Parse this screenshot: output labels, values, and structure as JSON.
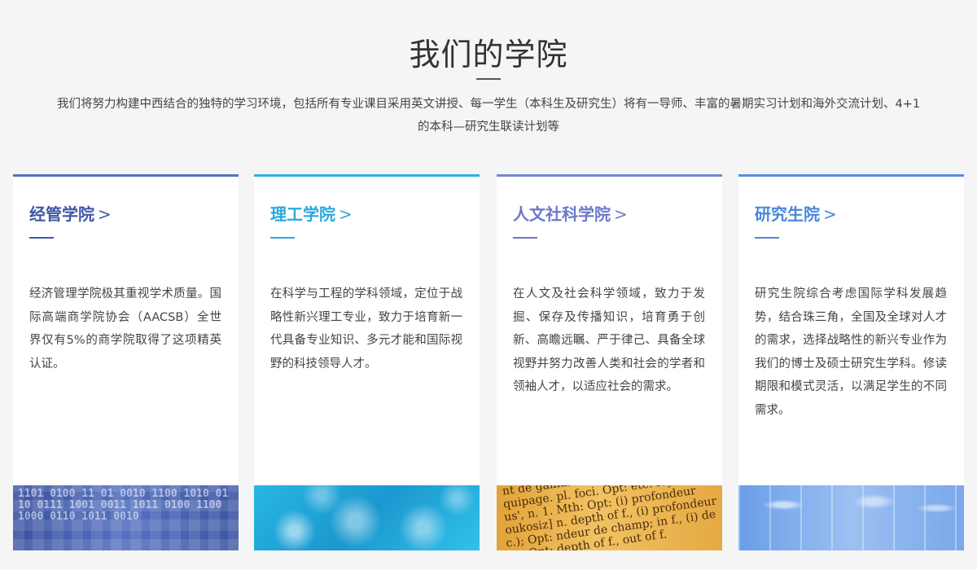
{
  "hero": {
    "title": "我们的学院",
    "description_line1": "我们将努力构建中西结合的独特的学习环境，包括所有专业课目采用英文讲授、每一学生（本科生及研究生）将有一导师、丰富的暑期实习计划和海外交流计划、4+1",
    "description_line2": "的本科—研究生联读计划等"
  },
  "arrow_glyph": ">",
  "cards": [
    {
      "title": "经管学院",
      "body": "经济管理学院极其重视学术质量。国际高端商学院协会（AACSB）全世界仅有5%的商学院取得了这项精英认证。",
      "accent": "#3f57a6",
      "image_text": "1101 0100 11 01 0010 1100 1010 0110 0111 1001 0011 1011 0100 1100 1000 0110 1011 0010"
    },
    {
      "title": "理工学院",
      "body": "在科学与工程的学科领域，定位于战略性新兴理工专业，致力于培育新一代具备专业知识、多元才能和国际视野的科技领导人才。",
      "accent": "#27a9de"
    },
    {
      "title": "人文社科学院",
      "body": "在人文及社会科学领域，致力于发掘、保存及传播知识，培育勇于创新、高瞻远瞩、严于律己、具备全球视野并努力改善人类和社会的学者和领袖人才，以适应社会的需求。",
      "accent": "#6b78c9",
      "image_lines": [
        "nt de gaillard.  foci, focuses foyer",
        "quipage.  pl.  foci.  Opt: etc: foyer",
        "us', n. 1. Mth: Opt: (i) profondeur",
        "oukosiz] n. depth of f., (i) profondeur",
        "c.); Opt: ndeur de champ; in f., (i) de",
        "c.); Opt: depth of f., out of f."
      ]
    },
    {
      "title": "研究生院",
      "body": "研究生院综合考虑国际学科发展趋势，结合珠三角，全国及全球对人才的需求，选择战略性的新兴专业作为我们的博士及硕士研究生学科。修读期限和模式灵活，以满足学生的不同需求。",
      "accent": "#4c87d8"
    }
  ]
}
